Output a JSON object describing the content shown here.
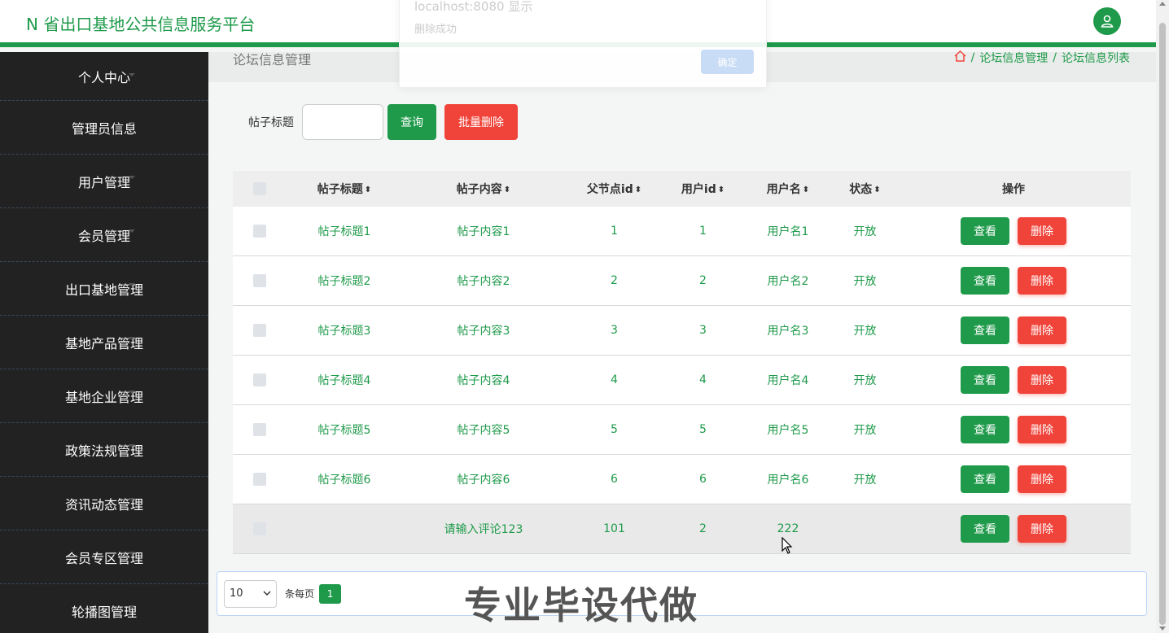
{
  "header": {
    "title": "N 省出口基地公共信息服务平台"
  },
  "sidebar": {
    "items": [
      {
        "label": "个人中心"
      },
      {
        "label": "管理员信息"
      },
      {
        "label": "用户管理"
      },
      {
        "label": "会员管理"
      },
      {
        "label": "出口基地管理"
      },
      {
        "label": "基地产品管理"
      },
      {
        "label": "基地企业管理"
      },
      {
        "label": "政策法规管理"
      },
      {
        "label": "资讯动态管理"
      },
      {
        "label": "会员专区管理"
      },
      {
        "label": "轮播图管理"
      }
    ]
  },
  "crumbbar": {
    "page_title": "论坛信息管理",
    "crumb1": "论坛信息管理",
    "crumb2": "论坛信息列表",
    "sep": "/"
  },
  "search": {
    "label": "帖子标题",
    "value": "",
    "query_label": "查询",
    "batch_delete_label": "批量删除"
  },
  "table": {
    "headers": [
      "帖子标题",
      "帖子内容",
      "父节点id",
      "用户id",
      "用户名",
      "状态",
      "操作"
    ],
    "sort_glyph": "⬍",
    "view_label": "查看",
    "delete_label": "删除",
    "rows": [
      {
        "title": "帖子标题1",
        "content": "帖子内容1",
        "pid": "1",
        "uid": "1",
        "uname": "用户名1",
        "status": "开放"
      },
      {
        "title": "帖子标题2",
        "content": "帖子内容2",
        "pid": "2",
        "uid": "2",
        "uname": "用户名2",
        "status": "开放"
      },
      {
        "title": "帖子标题3",
        "content": "帖子内容3",
        "pid": "3",
        "uid": "3",
        "uname": "用户名3",
        "status": "开放"
      },
      {
        "title": "帖子标题4",
        "content": "帖子内容4",
        "pid": "4",
        "uid": "4",
        "uname": "用户名4",
        "status": "开放"
      },
      {
        "title": "帖子标题5",
        "content": "帖子内容5",
        "pid": "5",
        "uid": "5",
        "uname": "用户名5",
        "status": "开放"
      },
      {
        "title": "帖子标题6",
        "content": "帖子内容6",
        "pid": "6",
        "uid": "6",
        "uname": "用户名6",
        "status": "开放"
      },
      {
        "title": "",
        "content": "请输入评论123",
        "pid": "101",
        "uid": "2",
        "uname": "222",
        "status": ""
      }
    ]
  },
  "pager": {
    "page_size": "10",
    "per_page_label": "条每页",
    "current_page": "1"
  },
  "watermark": "专业毕设代做",
  "dialog": {
    "title": "localhost:8080 显示",
    "message": "删除成功",
    "ok_label": "确定"
  },
  "colors": {
    "primary": "#1e9a4a",
    "danger": "#f0443a",
    "sidebar_bg": "#222222"
  }
}
